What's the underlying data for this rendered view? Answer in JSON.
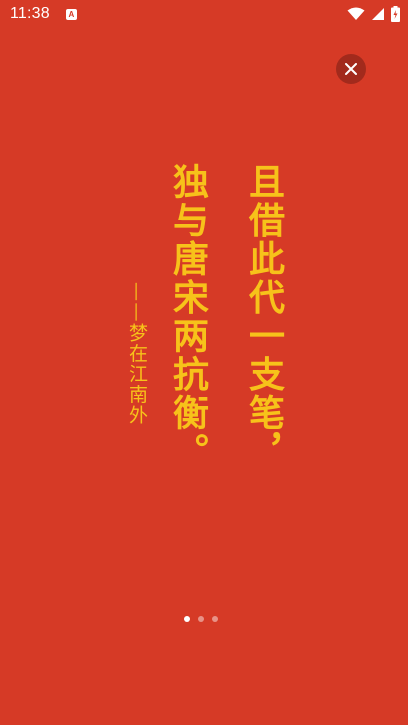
{
  "status_bar": {
    "time": "11:38",
    "notification_badge": "A",
    "icons": [
      "wifi-icon",
      "signal-icon",
      "battery-icon"
    ]
  },
  "poem": {
    "line1": "且借此代一支笔，",
    "line2": "独与唐宋两抗衡。",
    "attribution": "——梦在江南外"
  },
  "pager": {
    "total": 3,
    "active_index": 0
  },
  "colors": {
    "background": "#D63A26",
    "text_accent": "#F7C21A"
  },
  "close_icon": "close-icon"
}
